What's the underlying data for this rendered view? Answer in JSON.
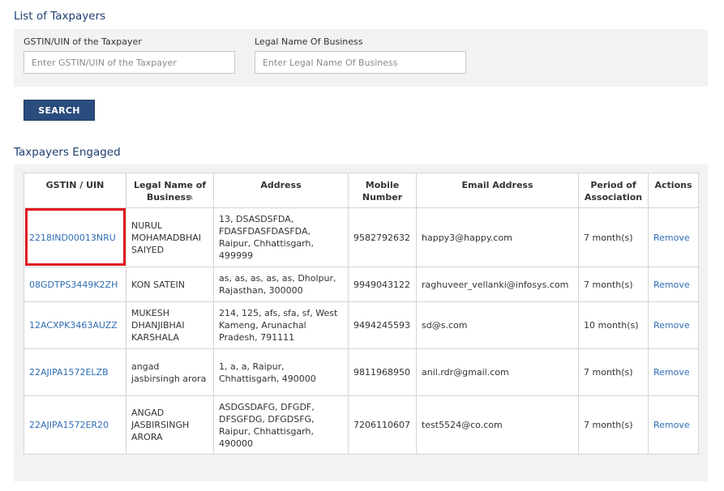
{
  "search": {
    "title": "List of Taxpayers",
    "gstin_label": "GSTIN/UIN of the Taxpayer",
    "gstin_placeholder": "Enter GSTIN/UIN of the Taxpayer",
    "gstin_value": "",
    "name_label": "Legal Name Of Business",
    "name_placeholder": "Enter Legal Name Of Business",
    "name_value": "",
    "button_label": "SEARCH"
  },
  "engaged": {
    "title": "Taxpayers Engaged",
    "columns": {
      "gstin": "GSTIN / UIN",
      "name": "Legal Name of Business",
      "address": "Address",
      "mobile": "Mobile Number",
      "email": "Email Address",
      "period": "Period of Association",
      "actions": "Actions"
    },
    "rows": [
      {
        "gstin": "2218IND00013NRU",
        "name": "NURUL MOHAMADBHAI SAIYED",
        "address": "13, DSASDSFDA, FDASFDASFDASFDA, Raipur, Chhattisgarh, 499999",
        "mobile": "9582792632",
        "email": "happy3@happy.com",
        "period": "7 month(s)",
        "action": "Remove"
      },
      {
        "gstin": "08GDTPS3449K2ZH",
        "name": "KON SATEIN",
        "address": "as, as, as, as, as, Dholpur, Rajasthan, 300000",
        "mobile": "9949043122",
        "email": "raghuveer_vellanki@infosys.com",
        "period": "7 month(s)",
        "action": "Remove"
      },
      {
        "gstin": "12ACXPK3463AUZZ",
        "name": "MUKESH DHANJIBHAI KARSHALA",
        "address": "214, 125, afs, sfa, sf, West Kameng, Arunachal Pradesh, 791111",
        "mobile": "9494245593",
        "email": "sd@s.com",
        "period": "10 month(s)",
        "action": "Remove"
      },
      {
        "gstin": "22AJIPA1572ELZB",
        "name": "angad jasbirsingh arora",
        "address": "1, a, a, Raipur, Chhattisgarh, 490000",
        "mobile": "9811968950",
        "email": "anil.rdr@gmail.com",
        "period": "7 month(s)",
        "action": "Remove"
      },
      {
        "gstin": "22AJIPA1572ER20",
        "name": "ANGAD JASBIRSINGH ARORA",
        "address": "ASDGSDAFG, DFGDF, DFSGFDG, DFGDSFG, Raipur, Chhattisgarh, 490000",
        "mobile": "7206110607",
        "email": "test5524@co.com",
        "period": "7 month(s)",
        "action": "Remove"
      }
    ]
  },
  "colors": {
    "title": "#1c3f6e",
    "button": "#2b4d7e",
    "link": "#2f6db3",
    "highlight": "#e0141e",
    "panel": "#f2f2f2"
  },
  "icons": {
    "sort": "sort-caret-icon"
  }
}
